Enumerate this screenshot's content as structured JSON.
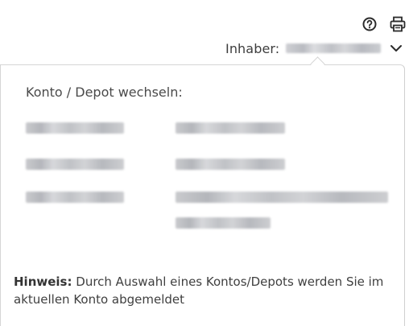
{
  "header": {
    "icons": [
      "help-icon",
      "print-icon"
    ],
    "owner_label": "Inhaber:",
    "owner_value_redacted": true
  },
  "dropdown": {
    "title": "Konto / Depot wechseln:",
    "accounts": [
      {
        "redacted": true,
        "name_lines": 1
      },
      {
        "redacted": true,
        "name_lines": 1
      },
      {
        "redacted": true,
        "name_lines": 2
      }
    ],
    "hint_label": "Hinweis:",
    "hint_text": "Durch Auswahl eines Kontos/Depots werden Sie im aktuellen Konto abgemeldet"
  },
  "colors": {
    "text": "#3a3a3a",
    "border": "#d5d5d5",
    "icon": "#2b2b2b"
  }
}
